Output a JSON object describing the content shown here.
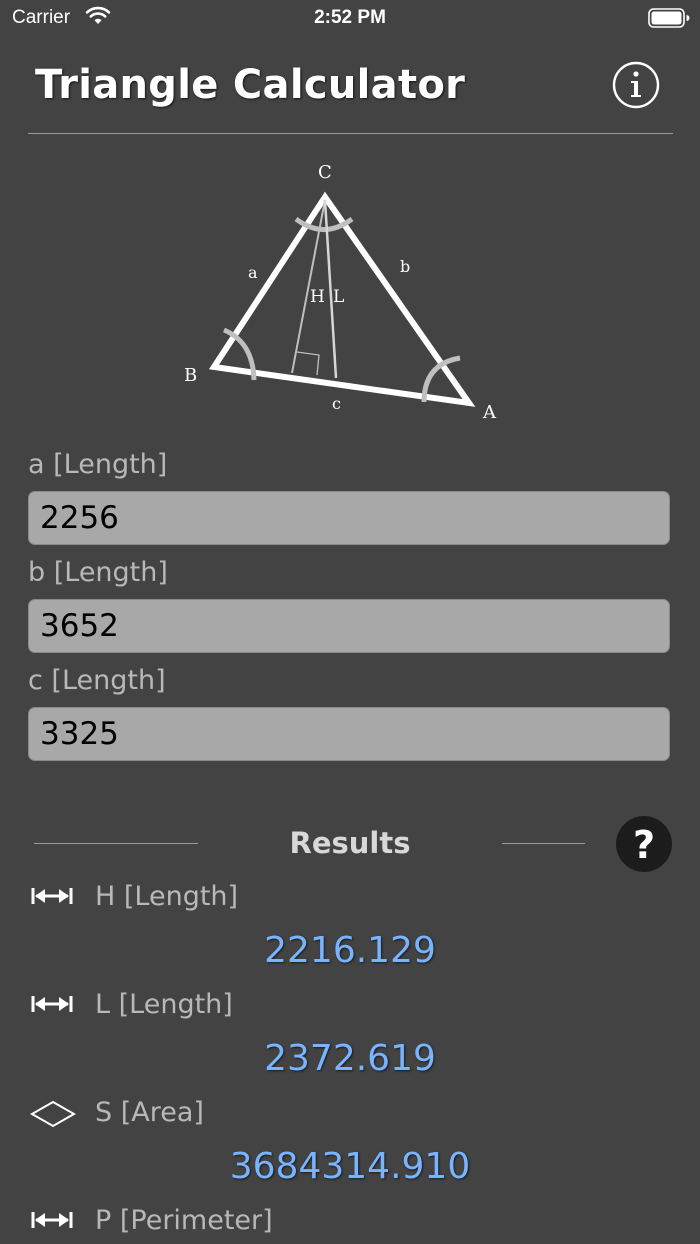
{
  "status": {
    "carrier": "Carrier",
    "time": "2:52 PM"
  },
  "header": {
    "title": "Triangle Calculator"
  },
  "diagram": {
    "vertex_c": "C",
    "vertex_b": "B",
    "vertex_a": "A",
    "side_a": "a",
    "side_b": "b",
    "side_c": "c",
    "height": "H",
    "line_l": "L"
  },
  "fields": {
    "a": {
      "label": "a [Length]",
      "value": "2256"
    },
    "b": {
      "label": "b [Length]",
      "value": "3652"
    },
    "c": {
      "label": "c [Length]",
      "value": "3325"
    }
  },
  "results": {
    "title": "Results",
    "items": [
      {
        "label": "H [Length]",
        "value": "2216.129",
        "icon": "length-arrows-icon"
      },
      {
        "label": "L [Length]",
        "value": "2372.619",
        "icon": "length-arrows-icon"
      },
      {
        "label": "S [Area]",
        "value": "3684314.910",
        "icon": "area-diamond-icon"
      },
      {
        "label": "P [Perimeter]",
        "icon": "length-arrows-icon"
      }
    ]
  },
  "colors": {
    "background": "#434343",
    "input_background": "#a8a8a8",
    "result_value": "#78b4ff"
  }
}
